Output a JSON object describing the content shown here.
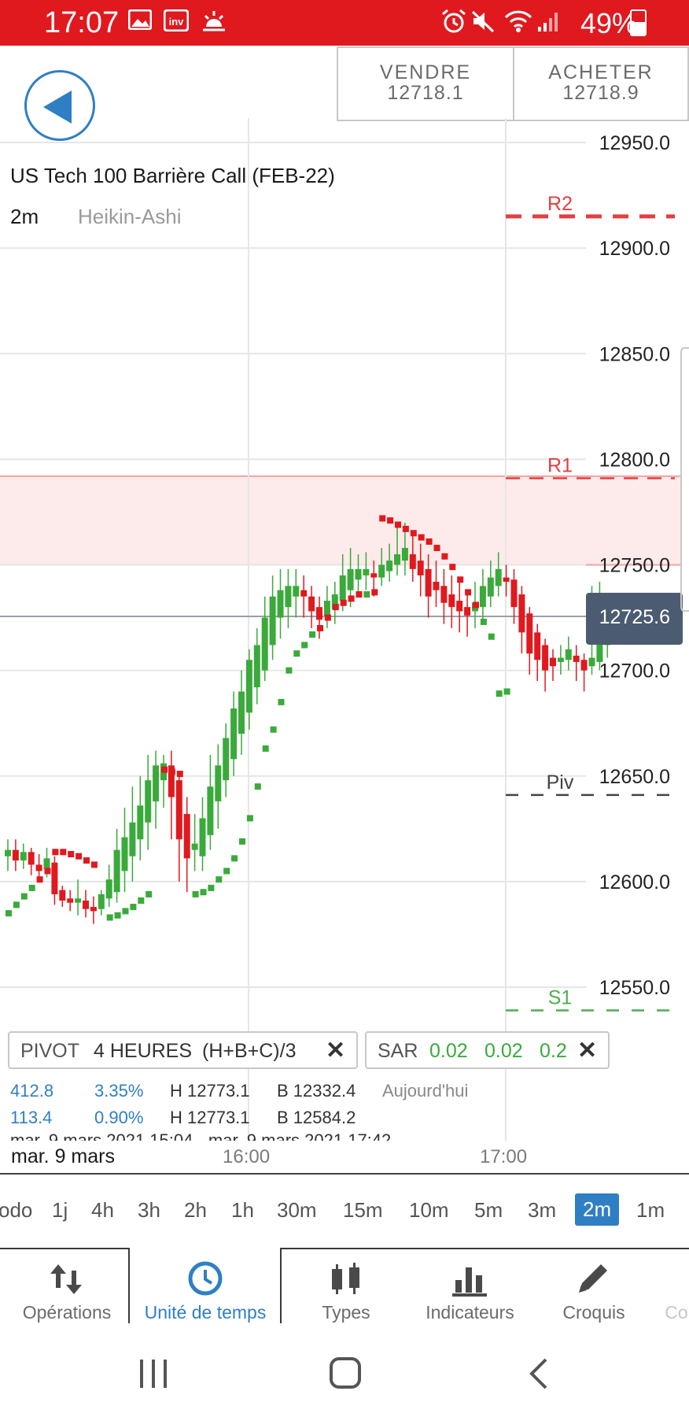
{
  "status_bar": {
    "time": "17:07",
    "battery": "49%",
    "icons": [
      "gallery-icon",
      "investing-app-icon",
      "weather-icon",
      "alarm-icon",
      "mute-icon",
      "wifi-icon",
      "signal-icon",
      "battery-icon"
    ],
    "color": "#e0191f"
  },
  "trade": {
    "sell_label": "VENDRE",
    "sell_price": "12718.1",
    "buy_label": "ACHETER",
    "buy_price": "12718.9"
  },
  "instrument": {
    "title": "US Tech 100 Barrière Call (FEB-22)",
    "timeframe": "2m",
    "chart_type": "Heikin-Ashi"
  },
  "chart_data": {
    "type": "candlestick",
    "chart_style": "Heikin-Ashi",
    "title": "US Tech 100 Barrière Call (FEB-22)",
    "y_axis_labels": [
      "12950.0",
      "12900.0",
      "12850.0",
      "12800.0",
      "12750.0",
      "12700.0",
      "12650.0",
      "12600.0",
      "12550.0"
    ],
    "ylim": [
      12530,
      12965
    ],
    "x_axis_labels": [
      "16:00",
      "17:00"
    ],
    "current_price": "12725.6",
    "current_price_value": 12725.6,
    "hidden_price_label": "12718.9",
    "grid": true,
    "levels": [
      {
        "name": "R2",
        "value": 12915,
        "color": "#e04040"
      },
      {
        "name": "R1",
        "value": 12791,
        "color": "#e04040"
      },
      {
        "name": "Piv",
        "value": 12641,
        "color": "#444444"
      },
      {
        "name": "S1",
        "value": 12539,
        "color": "#4caf50"
      }
    ],
    "highlight_zone": [
      12750,
      12792
    ],
    "up_color": "#3aaa3a",
    "down_color": "#e0191f",
    "candles": [
      [
        12612,
        12615,
        12620,
        12605
      ],
      [
        12615,
        12610,
        12620,
        12605
      ],
      [
        12610,
        12614,
        12618,
        12606
      ],
      [
        12614,
        12608,
        12616,
        12603
      ],
      [
        12608,
        12605,
        12613,
        12600
      ],
      [
        12606,
        12611,
        12616,
        12602
      ],
      [
        12609,
        12594,
        12612,
        12589
      ],
      [
        12596,
        12591,
        12598,
        12588
      ],
      [
        12592,
        12590,
        12596,
        12586
      ],
      [
        12590,
        12592,
        12601,
        12584
      ],
      [
        12591,
        12587,
        12596,
        12583
      ],
      [
        12588,
        12586,
        12593,
        12580
      ],
      [
        12587,
        12594,
        12596,
        12584
      ],
      [
        12592,
        12601,
        12608,
        12588
      ],
      [
        12595,
        12615,
        12625,
        12590
      ],
      [
        12605,
        12621,
        12635,
        12595
      ],
      [
        12612,
        12628,
        12645,
        12600
      ],
      [
        12620,
        12636,
        12650,
        12610
      ],
      [
        12628,
        12648,
        12660,
        12615
      ],
      [
        12638,
        12655,
        12662,
        12625
      ],
      [
        12648,
        12656,
        12660,
        12635
      ],
      [
        12655,
        12640,
        12662,
        12620
      ],
      [
        12648,
        12620,
        12652,
        12600
      ],
      [
        12632,
        12611,
        12640,
        12595
      ],
      [
        12615,
        12618,
        12632,
        12605
      ],
      [
        12612,
        12630,
        12640,
        12605
      ],
      [
        12622,
        12645,
        12660,
        12615
      ],
      [
        12638,
        12655,
        12665,
        12625
      ],
      [
        12648,
        12668,
        12675,
        12640
      ],
      [
        12658,
        12682,
        12690,
        12650
      ],
      [
        12670,
        12690,
        12700,
        12660
      ],
      [
        12680,
        12705,
        12710,
        12672
      ],
      [
        12692,
        12712,
        12720,
        12684
      ],
      [
        12700,
        12725,
        12735,
        12695
      ],
      [
        12712,
        12735,
        12745,
        12705
      ],
      [
        12725,
        12738,
        12748,
        12715
      ],
      [
        12730,
        12740,
        12748,
        12720
      ],
      [
        12735,
        12740,
        12748,
        12725
      ],
      [
        12738,
        12735,
        12745,
        12725
      ],
      [
        12735,
        12728,
        12740,
        12720
      ],
      [
        12730,
        12724,
        12735,
        12715
      ],
      [
        12726,
        12733,
        12740,
        12720
      ],
      [
        12729,
        12736,
        12742,
        12722
      ],
      [
        12733,
        12745,
        12755,
        12728
      ],
      [
        12738,
        12748,
        12758,
        12730
      ],
      [
        12743,
        12748,
        12755,
        12735
      ],
      [
        12745,
        12748,
        12756,
        12738
      ],
      [
        12746,
        12744,
        12752,
        12735
      ],
      [
        12744,
        12750,
        12758,
        12740
      ],
      [
        12747,
        12752,
        12760,
        12742
      ],
      [
        12750,
        12755,
        12768,
        12745
      ],
      [
        12752,
        12758,
        12770,
        12745
      ],
      [
        12755,
        12748,
        12766,
        12742
      ],
      [
        12752,
        12745,
        12760,
        12735
      ],
      [
        12748,
        12735,
        12755,
        12725
      ],
      [
        12742,
        12738,
        12752,
        12730
      ],
      [
        12740,
        12732,
        12748,
        12722
      ],
      [
        12736,
        12730,
        12745,
        12720
      ],
      [
        12733,
        12728,
        12742,
        12718
      ],
      [
        12730,
        12726,
        12738,
        12716
      ],
      [
        12728,
        12732,
        12742,
        12720
      ],
      [
        12730,
        12740,
        12748,
        12724
      ],
      [
        12735,
        12744,
        12752,
        12730
      ],
      [
        12740,
        12748,
        12756,
        12735
      ],
      [
        12744,
        12742,
        12750,
        12735
      ],
      [
        12743,
        12730,
        12748,
        12722
      ],
      [
        12736,
        12718,
        12740,
        12708
      ],
      [
        12727,
        12708,
        12730,
        12698
      ],
      [
        12718,
        12705,
        12722,
        12695
      ],
      [
        12712,
        12700,
        12715,
        12690
      ],
      [
        12706,
        12702,
        12710,
        12695
      ],
      [
        12704,
        12706,
        12712,
        12698
      ],
      [
        12705,
        12710,
        12716,
        12700
      ],
      [
        12707,
        12704,
        12712,
        12695
      ],
      [
        12705,
        12700,
        12708,
        12690
      ],
      [
        12702,
        12706,
        12740,
        12698
      ],
      [
        12704,
        12722,
        12742,
        12700
      ],
      [
        12712,
        12728,
        12735,
        12706
      ]
    ],
    "sar_points": [
      [
        0,
        12585
      ],
      [
        1,
        12589
      ],
      [
        2,
        12593
      ],
      [
        3,
        12597
      ],
      [
        4,
        12601
      ],
      [
        5,
        12605
      ],
      [
        6,
        12614
      ],
      [
        7,
        12614
      ],
      [
        8,
        12613
      ],
      [
        9,
        12612
      ],
      [
        10,
        12610
      ],
      [
        11,
        12608
      ],
      [
        13,
        12583
      ],
      [
        14,
        12584
      ],
      [
        15,
        12586
      ],
      [
        16,
        12588
      ],
      [
        17,
        12591
      ],
      [
        18,
        12594
      ],
      [
        20,
        12653
      ],
      [
        21,
        12652
      ],
      [
        22,
        12651
      ],
      [
        24,
        12594
      ],
      [
        25,
        12595
      ],
      [
        26,
        12597
      ],
      [
        27,
        12601
      ],
      [
        28,
        12605
      ],
      [
        29,
        12611
      ],
      [
        30,
        12619
      ],
      [
        31,
        12630
      ],
      [
        32,
        12645
      ],
      [
        33,
        12663
      ],
      [
        34,
        12672
      ],
      [
        35,
        12685
      ],
      [
        36,
        12700
      ],
      [
        37,
        12708
      ],
      [
        38,
        12712
      ],
      [
        39,
        12717
      ],
      [
        40,
        12720
      ],
      [
        41,
        12725
      ],
      [
        42,
        12730
      ],
      [
        43,
        12732
      ],
      [
        44,
        12734
      ],
      [
        45,
        12736
      ],
      [
        46,
        12736
      ],
      [
        47,
        12737
      ],
      [
        48,
        12772
      ],
      [
        49,
        12771
      ],
      [
        50,
        12769
      ],
      [
        51,
        12767
      ],
      [
        52,
        12765
      ],
      [
        53,
        12763
      ],
      [
        54,
        12761
      ],
      [
        55,
        12758
      ],
      [
        56,
        12754
      ],
      [
        57,
        12749
      ],
      [
        58,
        12743
      ],
      [
        59,
        12737
      ],
      [
        60,
        12731
      ],
      [
        61,
        12723
      ],
      [
        62,
        12716
      ],
      [
        63,
        12689
      ],
      [
        64,
        12690
      ]
    ]
  },
  "indicators": {
    "pivot": {
      "name": "PIVOT",
      "period": "4 HEURES",
      "formula": "(H+B+C)/3"
    },
    "sar": {
      "name": "SAR",
      "p1": "0.02",
      "p2": "0.02",
      "p3": "0.2"
    },
    "stats_rows": [
      {
        "v1": "412.8",
        "v2": "3.35%",
        "h": "H 12773.1",
        "b": "B 12332.4",
        "period": "Aujourd'hui"
      },
      {
        "v1": "113.4",
        "v2": "0.90%",
        "h": "H 12773.1",
        "b": "B 12584.2",
        "period": ""
      }
    ],
    "range_text": "mar. 9 mars 2021 15:04 - mar. 9 mars 2021 17:42"
  },
  "date_label": "mar. 9 mars",
  "x_axis": {
    "t1": "16:00",
    "t2": "17:00"
  },
  "timeframes": [
    "odo",
    "1j",
    "4h",
    "3h",
    "2h",
    "1h",
    "30m",
    "15m",
    "10m",
    "5m",
    "3m",
    "2m",
    "1m"
  ],
  "active_timeframe": "2m",
  "tabs": [
    {
      "label": "Opérations",
      "icon": "transfer-arrows-icon"
    },
    {
      "label": "Unité de temps",
      "icon": "clock-icon"
    },
    {
      "label": "Types",
      "icon": "candles-icon"
    },
    {
      "label": "Indicateurs",
      "icon": "bar-chart-icon"
    },
    {
      "label": "Croquis",
      "icon": "pencil-icon"
    },
    {
      "label": "Co",
      "icon": ""
    }
  ],
  "accent_color": "#2f7fc4"
}
